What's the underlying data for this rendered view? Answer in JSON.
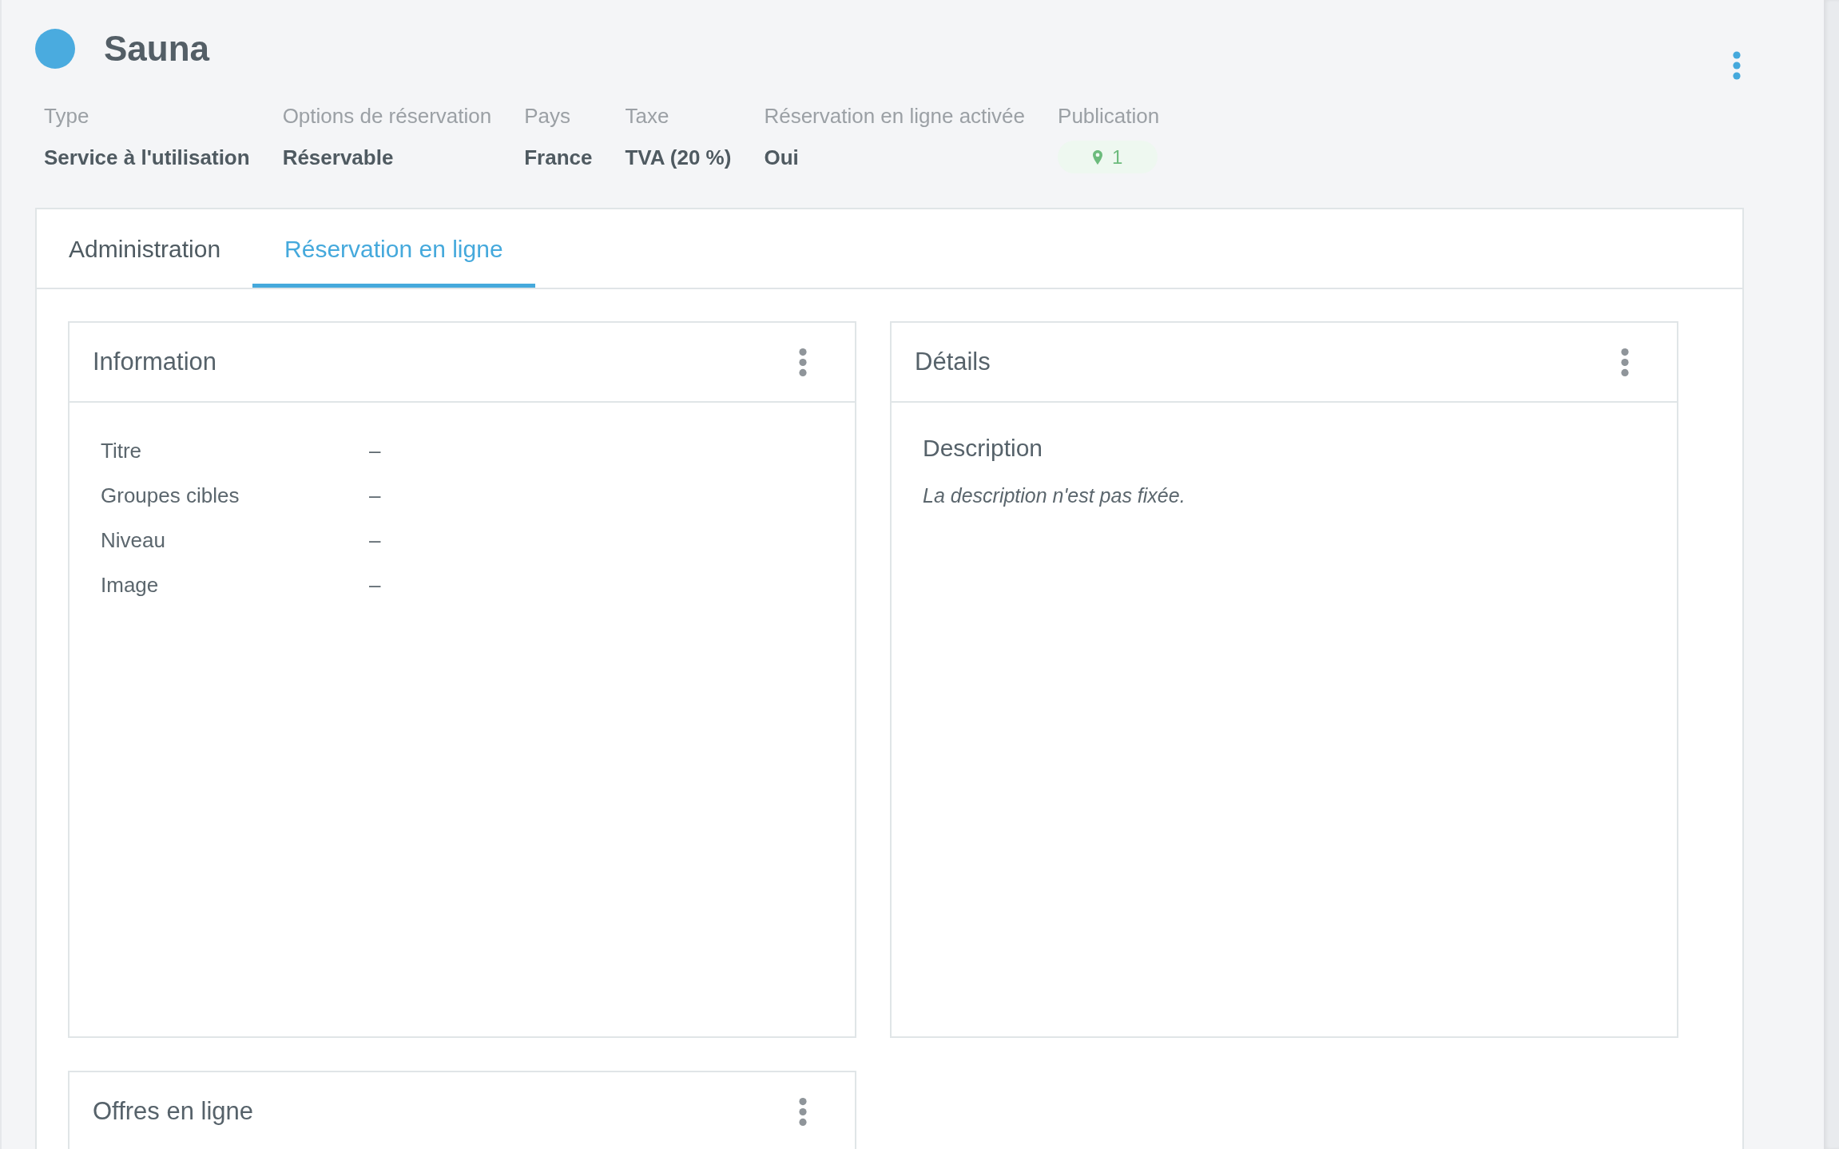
{
  "header": {
    "title": "Sauna",
    "properties": [
      {
        "label": "Type",
        "kind": "text",
        "value": "Service à l'utilisation"
      },
      {
        "label": "Options de réservation",
        "kind": "text",
        "value": "Réservable"
      },
      {
        "label": "Pays",
        "kind": "text",
        "value": "France"
      },
      {
        "label": "Taxe",
        "kind": "text",
        "value": "TVA (20 %)"
      },
      {
        "label": "Réservation en ligne activée",
        "kind": "text",
        "value": "Oui"
      },
      {
        "label": "Publication",
        "kind": "badge",
        "value": "1"
      }
    ]
  },
  "tabs": [
    {
      "label": "Administration",
      "selected": false
    },
    {
      "label": "Réservation en ligne",
      "selected": true
    }
  ],
  "cards": [
    {
      "title": "Information",
      "kind": "fields",
      "fields": [
        {
          "label": "Titre",
          "value": "–"
        },
        {
          "label": "Groupes cibles",
          "value": "–"
        },
        {
          "label": "Niveau",
          "value": "–"
        },
        {
          "label": "Image",
          "value": "–"
        }
      ]
    },
    {
      "title": "Détails",
      "kind": "description",
      "heading": "Description",
      "text": "La description n'est pas fixée."
    },
    {
      "title": "Offres en ligne",
      "kind": "empty"
    }
  ]
}
